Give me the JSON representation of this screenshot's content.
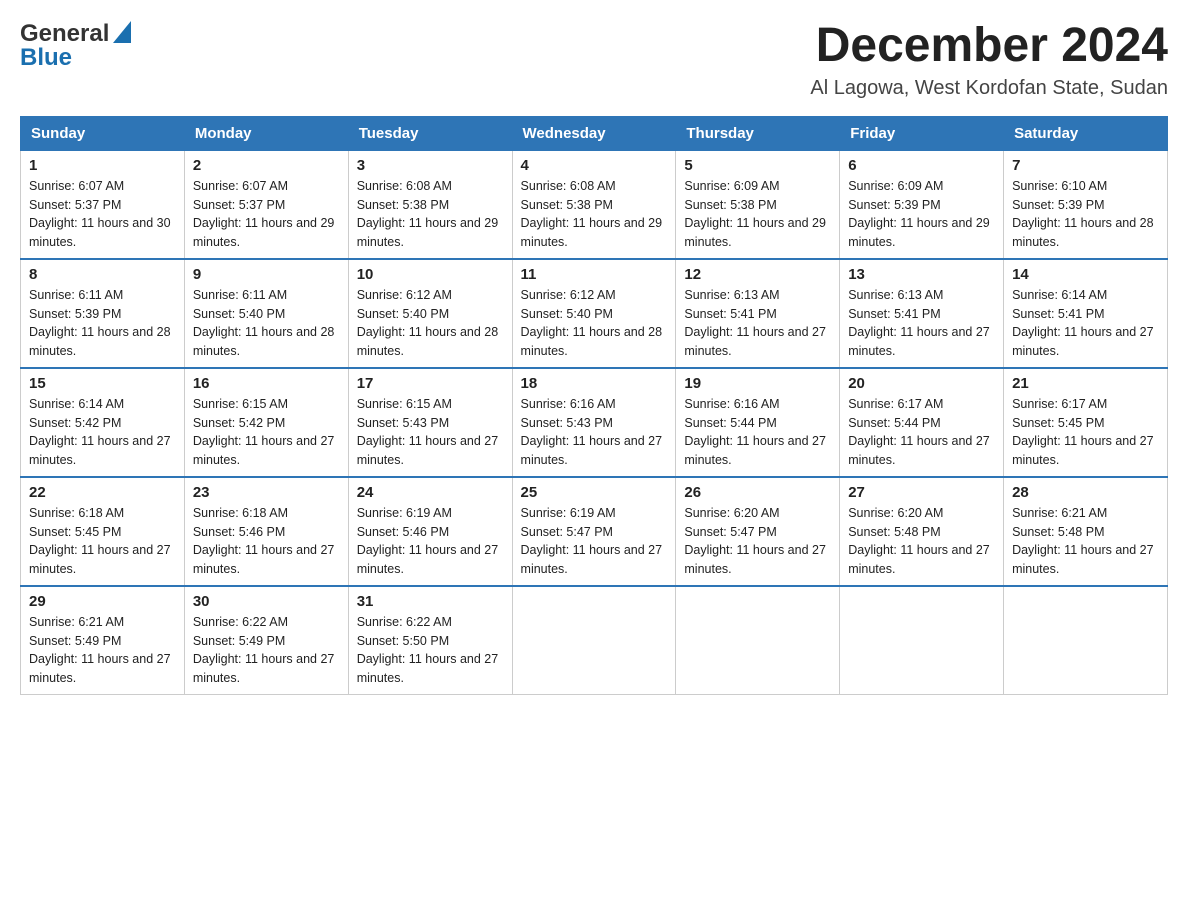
{
  "header": {
    "logo_general": "General",
    "logo_blue": "Blue",
    "month_title": "December 2024",
    "location": "Al Lagowa, West Kordofan State, Sudan"
  },
  "days_of_week": [
    "Sunday",
    "Monday",
    "Tuesday",
    "Wednesday",
    "Thursday",
    "Friday",
    "Saturday"
  ],
  "weeks": [
    [
      {
        "day": "1",
        "sunrise": "6:07 AM",
        "sunset": "5:37 PM",
        "daylight": "11 hours and 30 minutes."
      },
      {
        "day": "2",
        "sunrise": "6:07 AM",
        "sunset": "5:37 PM",
        "daylight": "11 hours and 29 minutes."
      },
      {
        "day": "3",
        "sunrise": "6:08 AM",
        "sunset": "5:38 PM",
        "daylight": "11 hours and 29 minutes."
      },
      {
        "day": "4",
        "sunrise": "6:08 AM",
        "sunset": "5:38 PM",
        "daylight": "11 hours and 29 minutes."
      },
      {
        "day": "5",
        "sunrise": "6:09 AM",
        "sunset": "5:38 PM",
        "daylight": "11 hours and 29 minutes."
      },
      {
        "day": "6",
        "sunrise": "6:09 AM",
        "sunset": "5:39 PM",
        "daylight": "11 hours and 29 minutes."
      },
      {
        "day": "7",
        "sunrise": "6:10 AM",
        "sunset": "5:39 PM",
        "daylight": "11 hours and 28 minutes."
      }
    ],
    [
      {
        "day": "8",
        "sunrise": "6:11 AM",
        "sunset": "5:39 PM",
        "daylight": "11 hours and 28 minutes."
      },
      {
        "day": "9",
        "sunrise": "6:11 AM",
        "sunset": "5:40 PM",
        "daylight": "11 hours and 28 minutes."
      },
      {
        "day": "10",
        "sunrise": "6:12 AM",
        "sunset": "5:40 PM",
        "daylight": "11 hours and 28 minutes."
      },
      {
        "day": "11",
        "sunrise": "6:12 AM",
        "sunset": "5:40 PM",
        "daylight": "11 hours and 28 minutes."
      },
      {
        "day": "12",
        "sunrise": "6:13 AM",
        "sunset": "5:41 PM",
        "daylight": "11 hours and 27 minutes."
      },
      {
        "day": "13",
        "sunrise": "6:13 AM",
        "sunset": "5:41 PM",
        "daylight": "11 hours and 27 minutes."
      },
      {
        "day": "14",
        "sunrise": "6:14 AM",
        "sunset": "5:41 PM",
        "daylight": "11 hours and 27 minutes."
      }
    ],
    [
      {
        "day": "15",
        "sunrise": "6:14 AM",
        "sunset": "5:42 PM",
        "daylight": "11 hours and 27 minutes."
      },
      {
        "day": "16",
        "sunrise": "6:15 AM",
        "sunset": "5:42 PM",
        "daylight": "11 hours and 27 minutes."
      },
      {
        "day": "17",
        "sunrise": "6:15 AM",
        "sunset": "5:43 PM",
        "daylight": "11 hours and 27 minutes."
      },
      {
        "day": "18",
        "sunrise": "6:16 AM",
        "sunset": "5:43 PM",
        "daylight": "11 hours and 27 minutes."
      },
      {
        "day": "19",
        "sunrise": "6:16 AM",
        "sunset": "5:44 PM",
        "daylight": "11 hours and 27 minutes."
      },
      {
        "day": "20",
        "sunrise": "6:17 AM",
        "sunset": "5:44 PM",
        "daylight": "11 hours and 27 minutes."
      },
      {
        "day": "21",
        "sunrise": "6:17 AM",
        "sunset": "5:45 PM",
        "daylight": "11 hours and 27 minutes."
      }
    ],
    [
      {
        "day": "22",
        "sunrise": "6:18 AM",
        "sunset": "5:45 PM",
        "daylight": "11 hours and 27 minutes."
      },
      {
        "day": "23",
        "sunrise": "6:18 AM",
        "sunset": "5:46 PM",
        "daylight": "11 hours and 27 minutes."
      },
      {
        "day": "24",
        "sunrise": "6:19 AM",
        "sunset": "5:46 PM",
        "daylight": "11 hours and 27 minutes."
      },
      {
        "day": "25",
        "sunrise": "6:19 AM",
        "sunset": "5:47 PM",
        "daylight": "11 hours and 27 minutes."
      },
      {
        "day": "26",
        "sunrise": "6:20 AM",
        "sunset": "5:47 PM",
        "daylight": "11 hours and 27 minutes."
      },
      {
        "day": "27",
        "sunrise": "6:20 AM",
        "sunset": "5:48 PM",
        "daylight": "11 hours and 27 minutes."
      },
      {
        "day": "28",
        "sunrise": "6:21 AM",
        "sunset": "5:48 PM",
        "daylight": "11 hours and 27 minutes."
      }
    ],
    [
      {
        "day": "29",
        "sunrise": "6:21 AM",
        "sunset": "5:49 PM",
        "daylight": "11 hours and 27 minutes."
      },
      {
        "day": "30",
        "sunrise": "6:22 AM",
        "sunset": "5:49 PM",
        "daylight": "11 hours and 27 minutes."
      },
      {
        "day": "31",
        "sunrise": "6:22 AM",
        "sunset": "5:50 PM",
        "daylight": "11 hours and 27 minutes."
      },
      null,
      null,
      null,
      null
    ]
  ]
}
